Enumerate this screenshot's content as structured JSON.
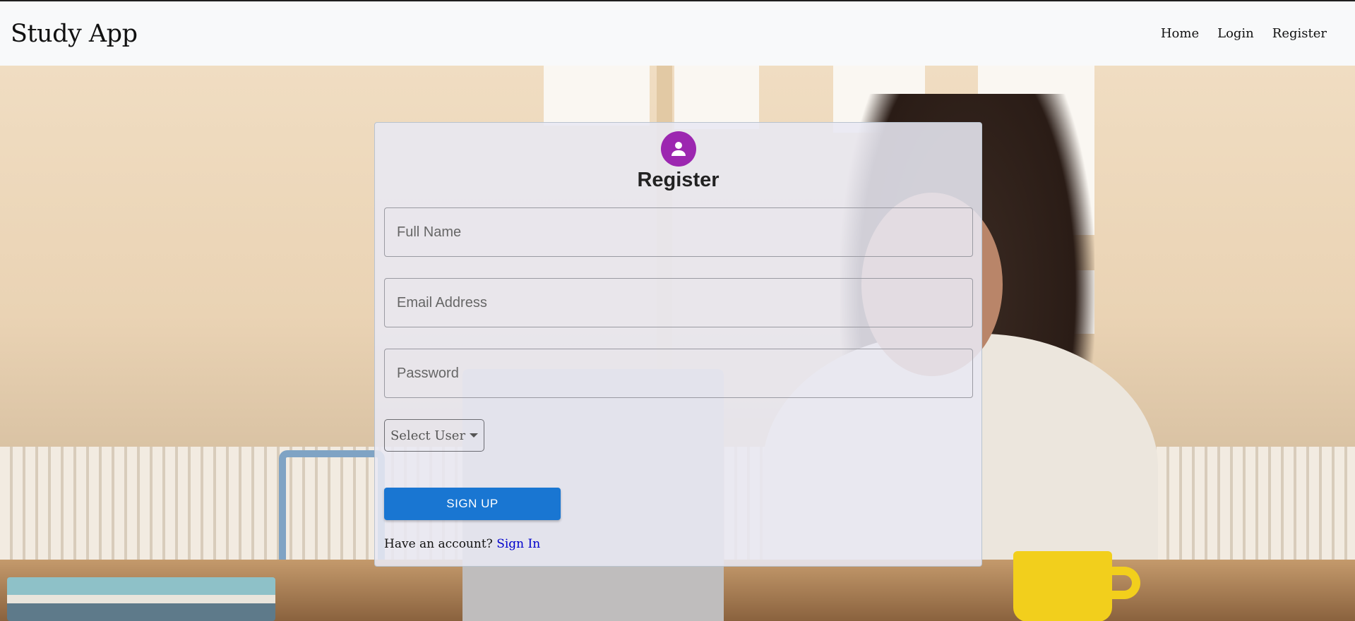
{
  "navbar": {
    "brand": "Study App",
    "links": [
      {
        "label": "Home"
      },
      {
        "label": "Login"
      },
      {
        "label": "Register"
      }
    ]
  },
  "form": {
    "icon": "person-icon",
    "title": "Register",
    "fields": {
      "full_name": {
        "placeholder": "Full Name",
        "value": ""
      },
      "email": {
        "placeholder": "Email Address",
        "value": ""
      },
      "password": {
        "placeholder": "Password",
        "value": ""
      }
    },
    "select_user_label": "Select User",
    "submit_label": "SIGN UP",
    "footer_prompt": "Have an account?",
    "footer_link": "Sign In"
  },
  "colors": {
    "accent": "#1976d2",
    "avatar": "#9c27b0",
    "link": "#0000cc"
  }
}
